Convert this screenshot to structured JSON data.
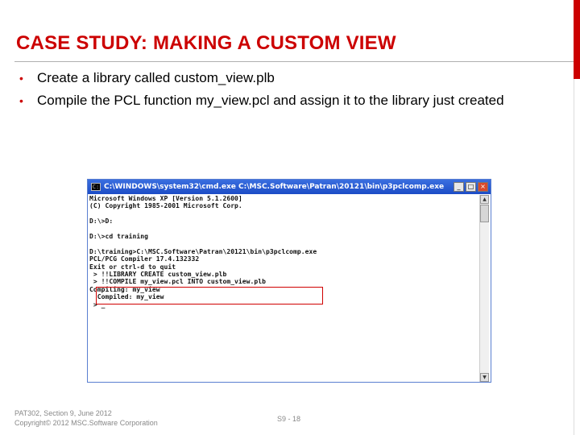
{
  "slide": {
    "title": "CASE STUDY: MAKING A CUSTOM VIEW",
    "bullets": [
      "Create a library called custom_view.plb",
      "Compile the PCL function my_view.pcl and assign it to the library just created"
    ]
  },
  "cmd_window": {
    "title": "C:\\WINDOWS\\system32\\cmd.exe  C:\\MSC.Software\\Patran\\20121\\bin\\p3pclcomp.exe",
    "buttons": {
      "minimize": "_",
      "maximize": "□",
      "close": "×"
    },
    "lines": [
      "Microsoft Windows XP [Version 5.1.2600]",
      "(C) Copyright 1985-2001 Microsoft Corp.",
      "",
      "D:\\>D:",
      "",
      "D:\\>cd training",
      "",
      "D:\\training>C:\\MSC.Software\\Patran\\20121\\bin\\p3pclcomp.exe",
      "PCL/PCG Compiler 17.4.132332",
      "Exit or ctrl-d to quit",
      " > !!LIBRARY CREATE custom_view.plb",
      " > !!COMPILE my_view.pcl INTO custom_view.plb",
      "Compiling: my_view",
      "  Compiled: my_view",
      " > _"
    ]
  },
  "footer": {
    "line1": "PAT302, Section 9, June 2012",
    "line2": "Copyright© 2012 MSC.Software Corporation",
    "page": "S9 - 18"
  },
  "colors": {
    "accent": "#cc0000",
    "titlebar": "#1c4cc6"
  },
  "icons": {
    "bullet": "bullet-dot-icon",
    "cmd": "cmd-window-icon"
  }
}
